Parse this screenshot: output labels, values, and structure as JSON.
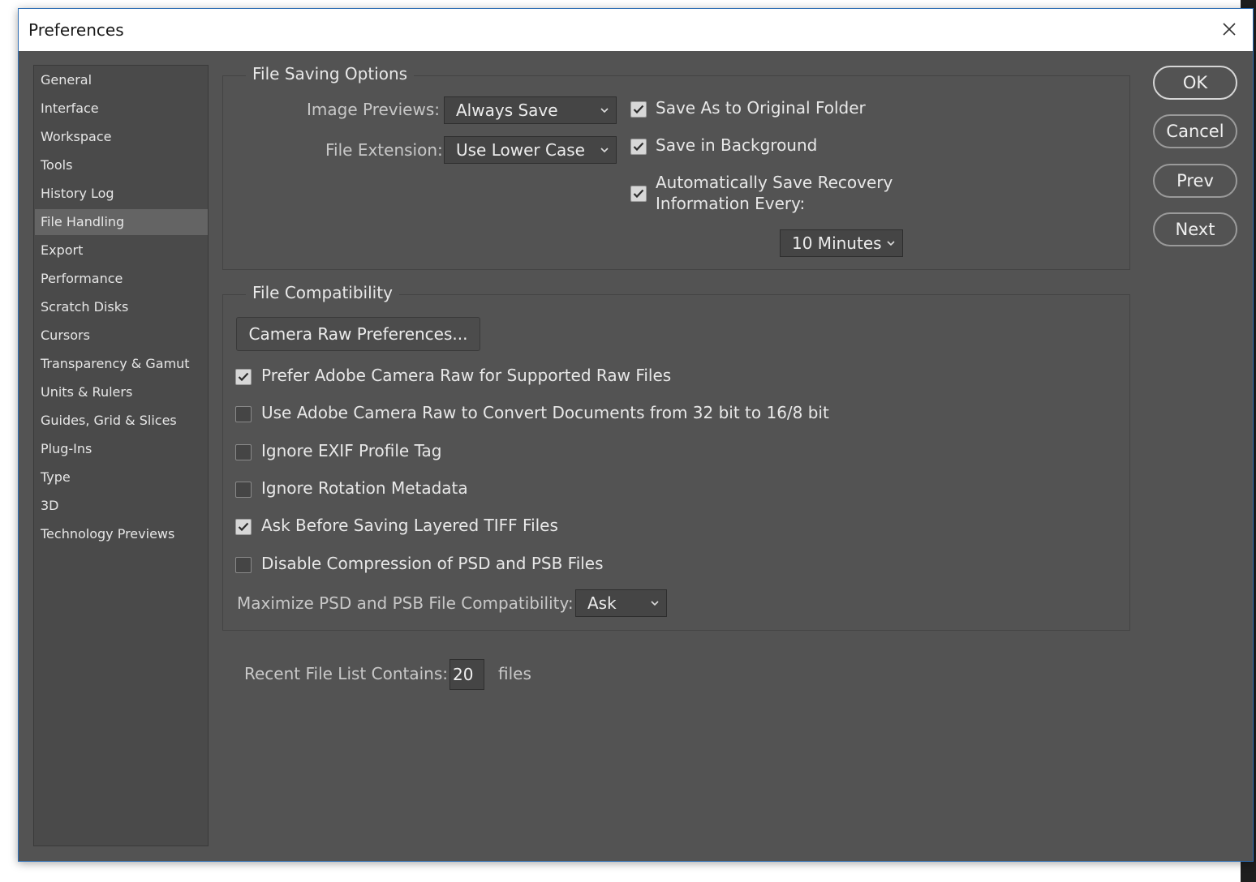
{
  "window": {
    "title": "Preferences"
  },
  "sidebar": {
    "items": [
      {
        "label": "General"
      },
      {
        "label": "Interface"
      },
      {
        "label": "Workspace"
      },
      {
        "label": "Tools"
      },
      {
        "label": "History Log"
      },
      {
        "label": "File Handling",
        "selected": true
      },
      {
        "label": "Export"
      },
      {
        "label": "Performance"
      },
      {
        "label": "Scratch Disks"
      },
      {
        "label": "Cursors"
      },
      {
        "label": "Transparency & Gamut"
      },
      {
        "label": "Units & Rulers"
      },
      {
        "label": "Guides, Grid & Slices"
      },
      {
        "label": "Plug-Ins"
      },
      {
        "label": "Type"
      },
      {
        "label": "3D"
      },
      {
        "label": "Technology Previews"
      }
    ]
  },
  "file_saving": {
    "legend": "File Saving Options",
    "image_previews_label": "Image Previews:",
    "image_previews_value": "Always Save",
    "file_extension_label": "File Extension:",
    "file_extension_value": "Use Lower Case",
    "save_original_folder": {
      "label": "Save As to Original Folder",
      "checked": true
    },
    "save_background": {
      "label": "Save in Background",
      "checked": true
    },
    "auto_save": {
      "label_line1": "Automatically Save Recovery",
      "label_line2": "Information Every:",
      "checked": true
    },
    "auto_save_interval": "10 Minutes"
  },
  "file_compat": {
    "legend": "File Compatibility",
    "camera_raw_button": "Camera Raw Preferences...",
    "options": [
      {
        "label": "Prefer Adobe Camera Raw for Supported Raw Files",
        "checked": true
      },
      {
        "label": "Use Adobe Camera Raw to Convert Documents from 32 bit to 16/8 bit",
        "checked": false
      },
      {
        "label": "Ignore EXIF Profile Tag",
        "checked": false
      },
      {
        "label": "Ignore Rotation Metadata",
        "checked": false
      },
      {
        "label": "Ask Before Saving Layered TIFF Files",
        "checked": true
      },
      {
        "label": "Disable Compression of PSD and PSB Files",
        "checked": false
      }
    ],
    "maximize_label": "Maximize PSD and PSB File Compatibility:",
    "maximize_value": "Ask"
  },
  "recent_files": {
    "label": "Recent File List Contains:",
    "value": "20",
    "suffix": "files"
  },
  "buttons": {
    "ok": "OK",
    "cancel": "Cancel",
    "prev": "Prev",
    "next": "Next"
  },
  "colors": {
    "panel_bg": "#535353",
    "sidebar_bg": "#4a4a4a",
    "selected_item": "#646464",
    "accent_border": "#2f6fb5"
  }
}
